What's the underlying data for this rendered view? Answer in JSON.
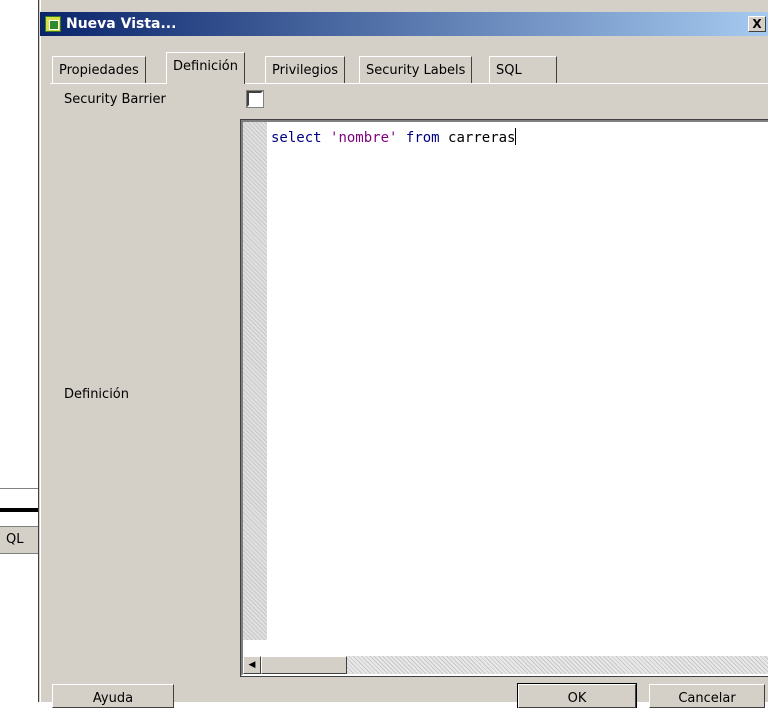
{
  "background_window": {
    "tab_label": "QL"
  },
  "dialog": {
    "title": "Nueva Vista...",
    "close_label": "X"
  },
  "tabs": [
    {
      "label": "Propiedades",
      "active": false
    },
    {
      "label": "Definición",
      "active": true
    },
    {
      "label": "Privilegios",
      "active": false
    },
    {
      "label": "Security Labels",
      "active": false
    },
    {
      "label": "SQL",
      "active": false
    }
  ],
  "definition_tab": {
    "security_barrier_label": "Security Barrier",
    "security_barrier_checked": false,
    "definition_label": "Definición",
    "sql": {
      "keyword_select": "select",
      "string_value": "'nombre'",
      "keyword_from": "from",
      "table": "carreras"
    }
  },
  "buttons": {
    "help": "Ayuda",
    "ok": "OK",
    "cancel": "Cancelar"
  },
  "colors": {
    "title_gradient_start": "#0a246a",
    "title_gradient_end": "#a6caf0",
    "face": "#d4d0c8",
    "keyword": "#00007f",
    "string": "#7f007f"
  },
  "icons": {
    "app": "view-icon",
    "scroll_left": "arrow-left-icon",
    "scroll_right": "arrow-right-icon"
  }
}
